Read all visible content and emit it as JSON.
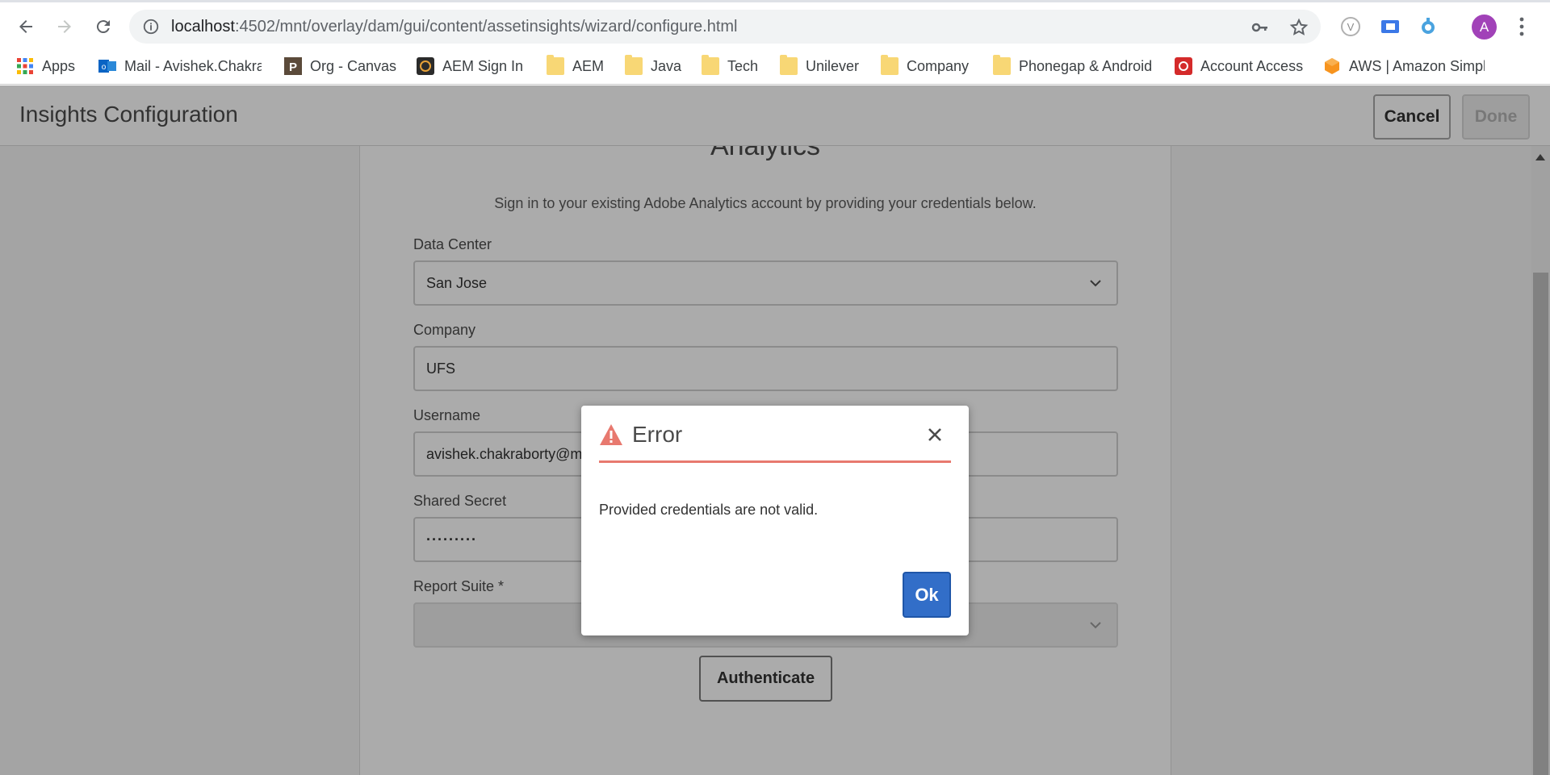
{
  "browser": {
    "url_host": "localhost",
    "url_path": ":4502/mnt/overlay/dam/gui/content/assetinsights/wizard/configure.html",
    "avatar_letter": "A",
    "extension_v_letter": "V"
  },
  "bookmarks": [
    {
      "label": "Apps",
      "icon": "apps-grid-icon"
    },
    {
      "label": "Mail - Avishek.Chakra",
      "icon": "outlook-icon"
    },
    {
      "label": "Org - Canvas",
      "icon": "canvas-icon"
    },
    {
      "label": "AEM Sign In",
      "icon": "aem-icon"
    },
    {
      "label": "AEM",
      "icon": "folder-icon"
    },
    {
      "label": "Java",
      "icon": "folder-icon"
    },
    {
      "label": "Tech",
      "icon": "folder-icon"
    },
    {
      "label": "Unilever",
      "icon": "folder-icon"
    },
    {
      "label": "Company",
      "icon": "folder-icon"
    },
    {
      "label": "Phonegap & Android",
      "icon": "folder-icon"
    },
    {
      "label": "Account Access",
      "icon": "account-access-icon"
    },
    {
      "label": "AWS | Amazon Simpl",
      "icon": "aws-icon"
    }
  ],
  "header": {
    "title": "Insights Configuration",
    "cancel_label": "Cancel",
    "done_label": "Done"
  },
  "form": {
    "title": "Analytics",
    "subtitle": "Sign in to your existing Adobe Analytics account by providing your credentials below.",
    "data_center_label": "Data Center",
    "data_center_value": "San Jose",
    "company_label": "Company",
    "company_value": "UFS",
    "username_label": "Username",
    "username_value": "avishek.chakraborty@m",
    "secret_label": "Shared Secret",
    "secret_value": "·········",
    "report_suite_label": "Report Suite *",
    "report_suite_value": "",
    "authenticate_label": "Authenticate"
  },
  "dialog": {
    "title": "Error",
    "message": "Provided credentials are not valid.",
    "ok_label": "Ok"
  },
  "colors": {
    "error_accent": "#e8796f",
    "primary_button": "#326ec8"
  }
}
